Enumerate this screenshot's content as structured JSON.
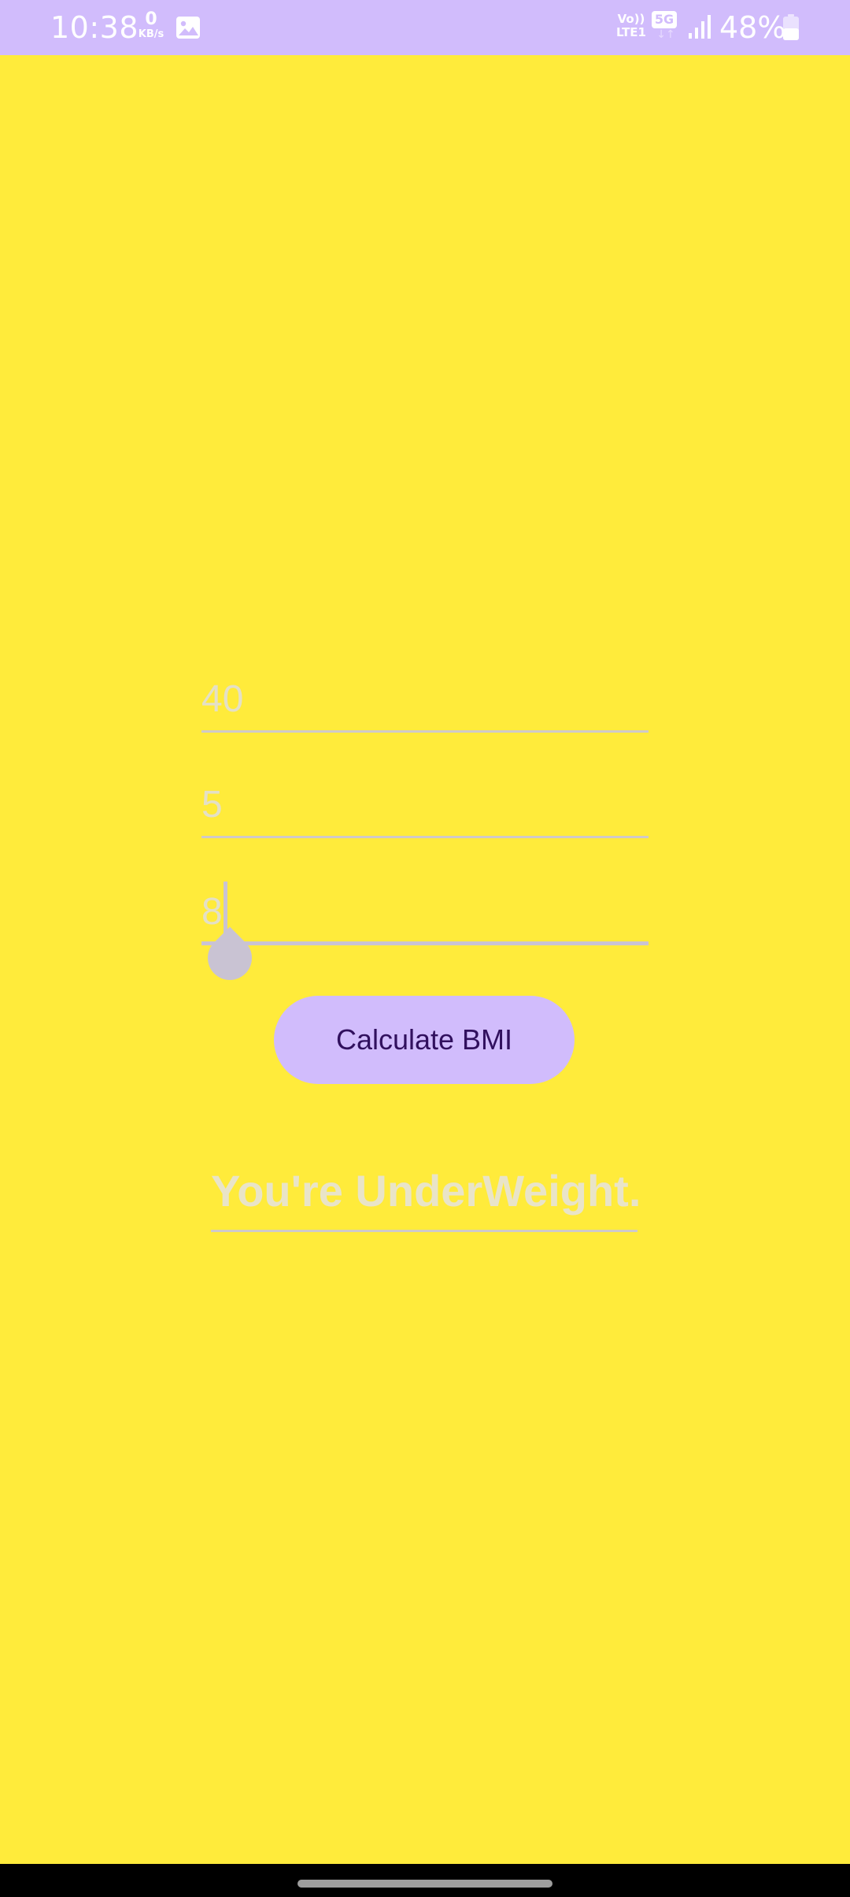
{
  "status_bar": {
    "time": "10:38",
    "net_speed_value": "0",
    "net_speed_unit": "KB/s",
    "volte_line1": "Vo))",
    "volte_line2": "LTE1",
    "network_type": "5G",
    "battery_percent": "48%",
    "background_color": "#D1BCFC",
    "icons": [
      "gallery-icon",
      "volte-icon",
      "5g-icon",
      "signal-icon",
      "battery-icon"
    ]
  },
  "form": {
    "weight_value": "40",
    "height_feet_value": "5",
    "height_inches_value": "8"
  },
  "button": {
    "calculate_label": "Calculate BMI",
    "background_color": "#D1BCFC",
    "text_color": "#31105E"
  },
  "result": {
    "text": "You're UnderWeight."
  },
  "theme": {
    "background_color": "#FFEB3B",
    "field_text_color": "#E4E0C6"
  }
}
